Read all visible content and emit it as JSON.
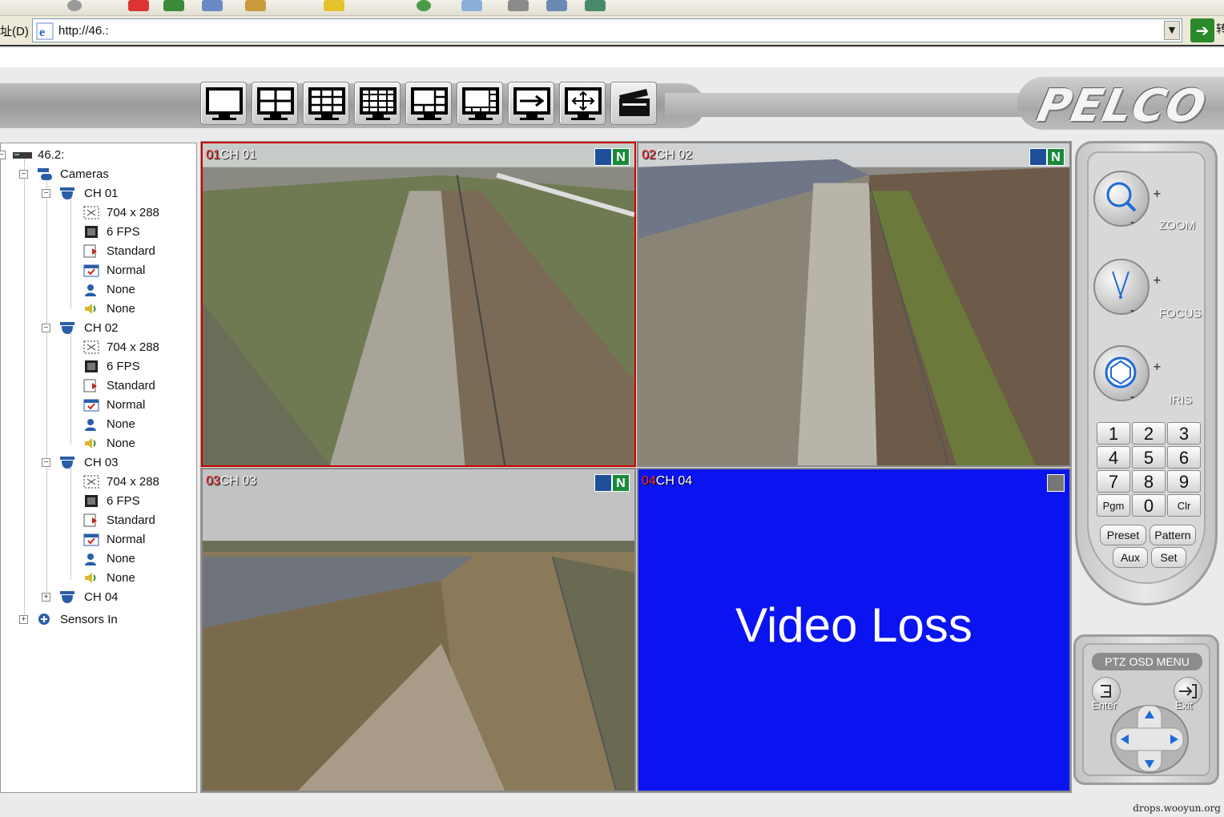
{
  "browser": {
    "toolbar_text_1": "",
    "toolbar_text_2": "",
    "toolbar_text_3": "",
    "address_label": "址(D)",
    "address_url": "http://46.:",
    "address_extra": "转"
  },
  "toolbar": {
    "layouts": [
      "single",
      "quad",
      "nine",
      "sixteen",
      "six",
      "eight",
      "sequence",
      "move",
      "close"
    ]
  },
  "logo": "PELCO",
  "tree": {
    "root": "46.2:",
    "cameras": "Cameras",
    "channels": [
      {
        "name": "CH 01",
        "props": [
          "704 x 288",
          "6 FPS",
          "Standard",
          "Normal",
          "None",
          "None"
        ]
      },
      {
        "name": "CH 02",
        "props": [
          "704 x 288",
          "6 FPS",
          "Standard",
          "Normal",
          "None",
          "None"
        ]
      },
      {
        "name": "CH 03",
        "props": [
          "704 x 288",
          "6 FPS",
          "Standard",
          "Normal",
          "None",
          "None"
        ]
      },
      {
        "name": "CH 04",
        "props": []
      }
    ],
    "sensors": "Sensors In"
  },
  "video": {
    "tiles": [
      {
        "num": "01",
        "label": "CH 01",
        "badge": "N",
        "selected": true
      },
      {
        "num": "02",
        "label": "CH 02",
        "badge": "N",
        "selected": false
      },
      {
        "num": "03",
        "label": "CH 03",
        "badge": "N",
        "selected": false
      },
      {
        "num": "04",
        "label": "CH 04",
        "badge": "",
        "selected": false
      }
    ],
    "video_loss": "Video Loss"
  },
  "ptz": {
    "zoom": "ZOOM",
    "focus": "FOCUS",
    "iris": "IRIS",
    "plus": "+",
    "minus": "-",
    "keys": [
      "1",
      "2",
      "3",
      "4",
      "5",
      "6",
      "7",
      "8",
      "9",
      "Pgm",
      "0",
      "Clr"
    ],
    "preset": "Preset",
    "pattern": "Pattern",
    "aux": "Aux",
    "set": "Set"
  },
  "osd": {
    "title": "PTZ OSD MENU",
    "enter": "Enter",
    "exit": "Exit"
  },
  "watermark": "drops.wooyun.org",
  "colors": {
    "video_loss_bg": "#0a14f0",
    "selected_border": "#cc0000",
    "channel_num": "#ff3030"
  }
}
